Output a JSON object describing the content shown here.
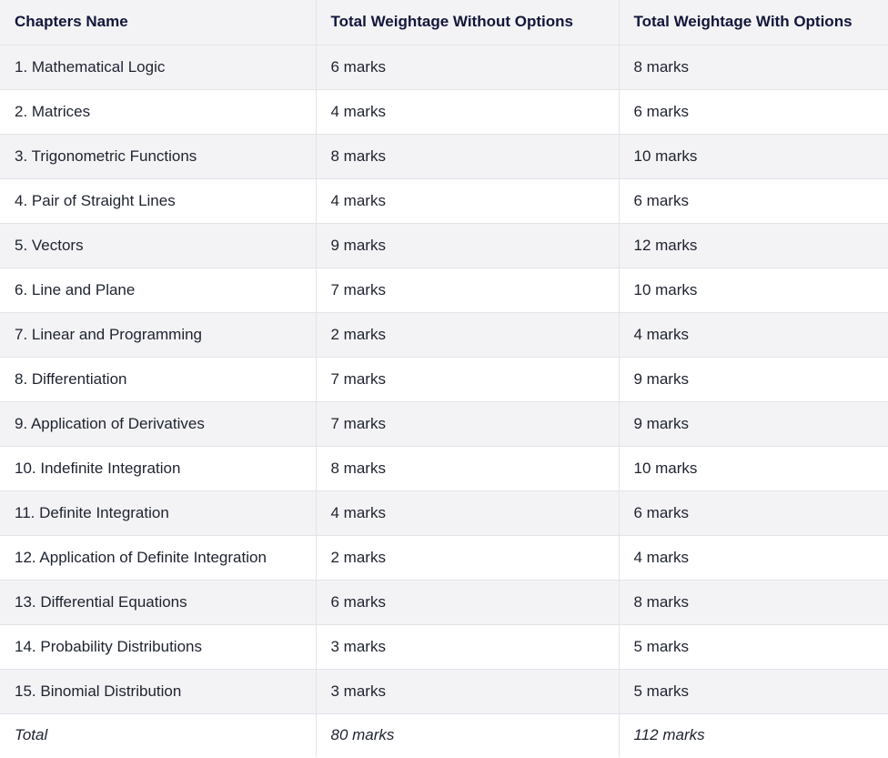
{
  "table": {
    "headers": [
      "Chapters Name",
      "Total Weightage Without Options",
      "Total Weightage With Options"
    ],
    "rows": [
      [
        "1. Mathematical Logic",
        "6 marks",
        "8 marks"
      ],
      [
        "2. Matrices",
        "4 marks",
        "6 marks"
      ],
      [
        "3. Trigonometric Functions",
        "8 marks",
        "10 marks"
      ],
      [
        "4. Pair of Straight Lines",
        "4 marks",
        "6 marks"
      ],
      [
        "5. Vectors",
        "9 marks",
        "12 marks"
      ],
      [
        "6. Line and Plane",
        "7 marks",
        "10 marks"
      ],
      [
        "7. Linear and Programming",
        "2 marks",
        "4 marks"
      ],
      [
        "8. Differentiation",
        "7 marks",
        "9 marks"
      ],
      [
        "9. Application of Derivatives",
        "7 marks",
        "9 marks"
      ],
      [
        "10. Indefinite Integration",
        "8 marks",
        "10 marks"
      ],
      [
        "11. Definite Integration",
        "4 marks",
        "6 marks"
      ],
      [
        "12. Application of Definite Integration",
        "2 marks",
        "4 marks"
      ],
      [
        "13. Differential Equations",
        "6 marks",
        "8 marks"
      ],
      [
        "14. Probability Distributions",
        "3 marks",
        "5 marks"
      ],
      [
        "15. Binomial Distribution",
        "3 marks",
        "5 marks"
      ]
    ],
    "total": [
      "Total",
      "80 marks",
      "112 marks"
    ]
  }
}
